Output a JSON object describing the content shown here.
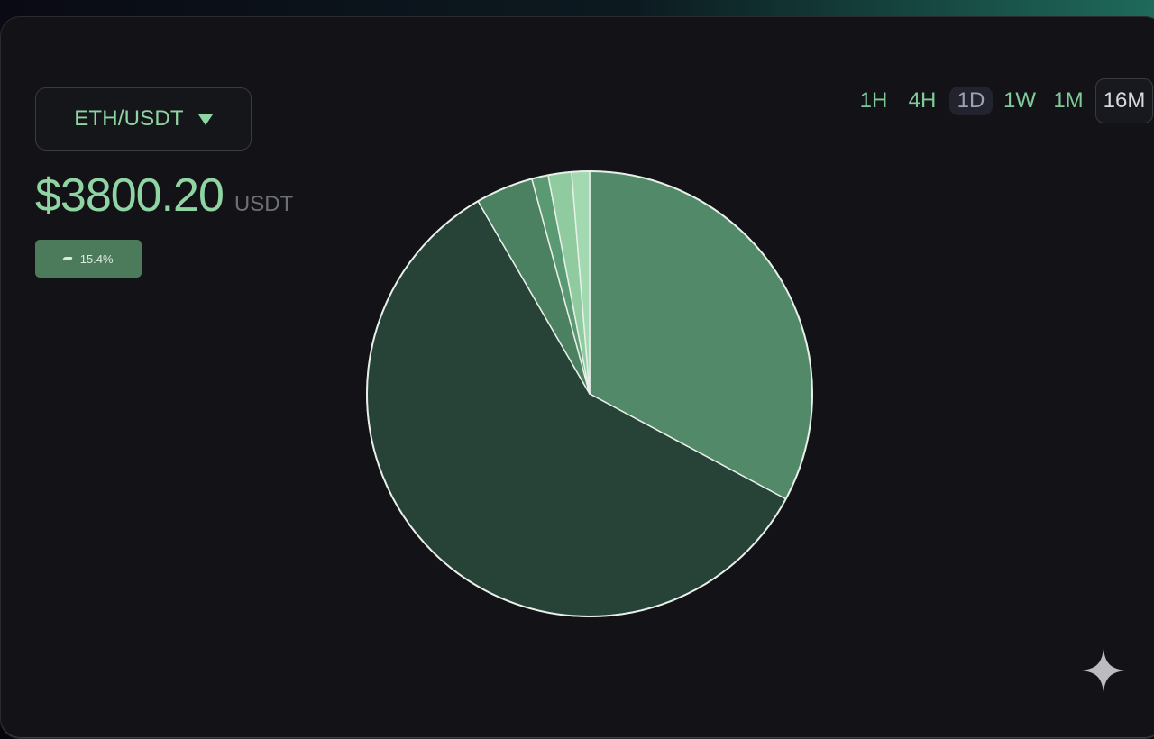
{
  "pair": {
    "label": "ETH/USDT",
    "caret_icon": "caret-down-icon"
  },
  "price": {
    "value": "$3800.20",
    "unit": "USDT"
  },
  "change": {
    "text": "-15.4%",
    "icon": "trend-icon"
  },
  "timeframes": [
    {
      "label": "1H",
      "state": "normal"
    },
    {
      "label": "4H",
      "state": "normal"
    },
    {
      "label": "1D",
      "state": "selected"
    },
    {
      "label": "1W",
      "state": "normal"
    },
    {
      "label": "1M",
      "state": "normal"
    },
    {
      "label": "16M",
      "state": "boxed"
    }
  ],
  "colors": {
    "accent": "#8fd4a3",
    "panel": "#131317",
    "badge": "#4c7b5b",
    "slice_outline": "#e8efe9"
  },
  "watermark_icon": "sparkle-icon",
  "chart_data": {
    "type": "pie",
    "title": "",
    "start_angle_deg": 0,
    "direction": "clockwise",
    "slices": [
      {
        "value": 33.0,
        "color": "#528a69"
      },
      {
        "value": 59.1,
        "color": "#274236"
      },
      {
        "value": 4.2,
        "color": "#4b8160"
      },
      {
        "value": 1.2,
        "color": "#5a9a72"
      },
      {
        "value": 1.7,
        "color": "#8fcb9e"
      },
      {
        "value": 1.3,
        "color": "#a3d9b0"
      }
    ]
  }
}
